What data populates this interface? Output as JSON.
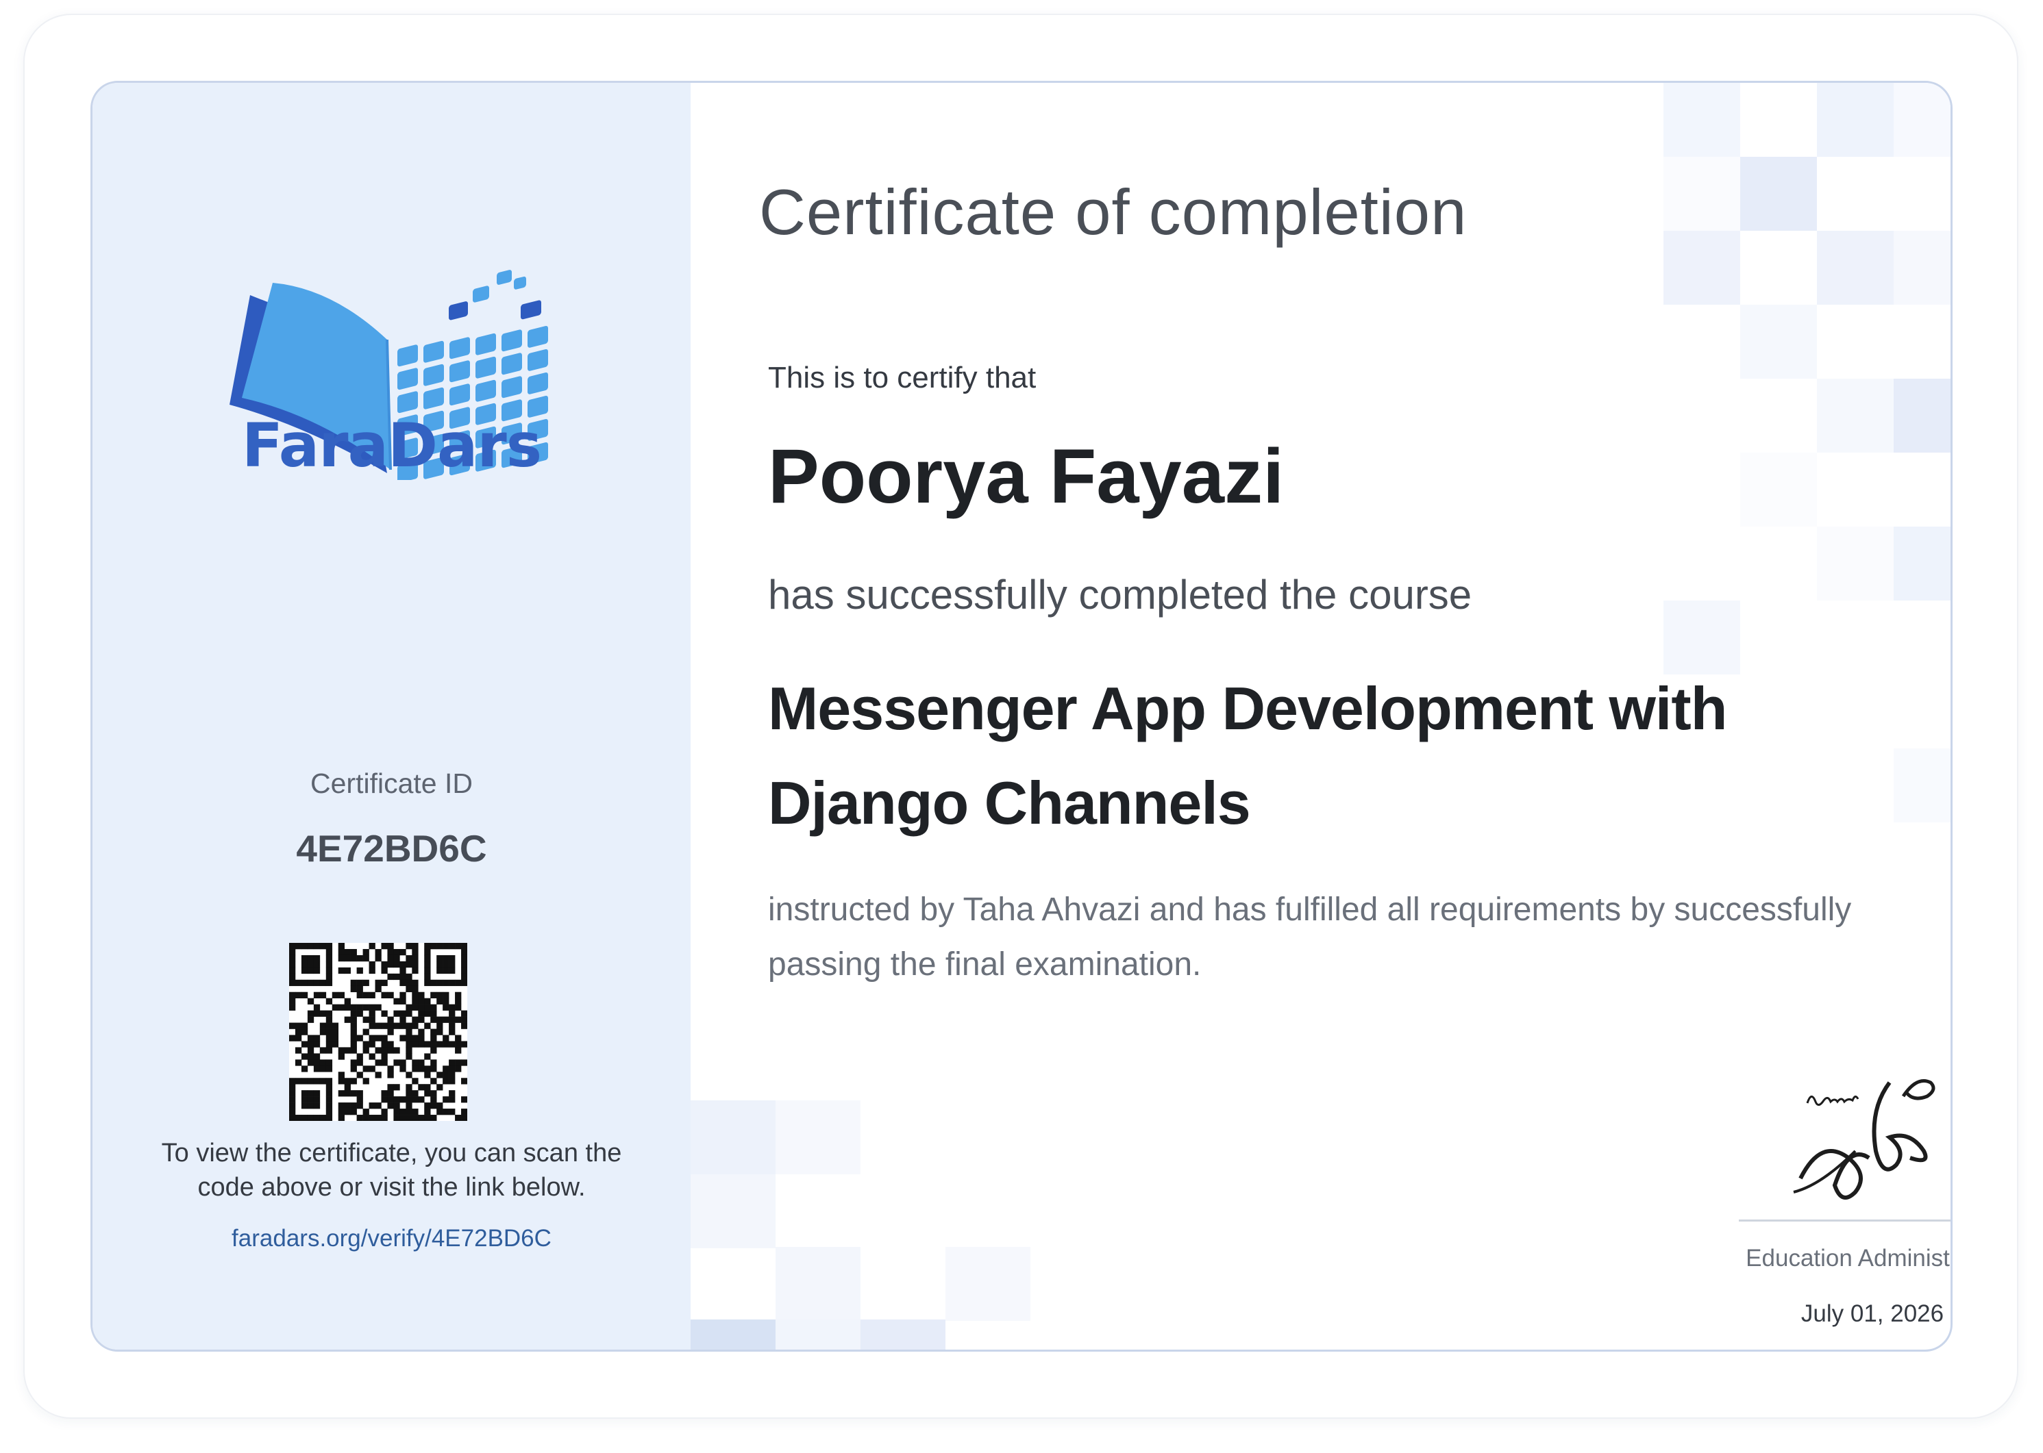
{
  "brand": {
    "name": "FaraDars"
  },
  "certificate": {
    "title": "Certificate of completion",
    "certify_text": "This is to certify that",
    "recipient_name": "Poorya Fayazi",
    "completed_text": "has successfully completed the course",
    "course_name": "Messenger App Development with Django Channels",
    "instructor_text": "instructed by Taha Ahvazi and has fulfilled all requirements by successfully passing the final examination."
  },
  "sidebar": {
    "id_label": "Certificate ID",
    "id_value": "4E72BD6C",
    "scan_text": "To view the certificate, you can scan the code above or visit the link below.",
    "verify_link": "faradars.org/verify/4E72BD6C"
  },
  "signature": {
    "role": "Education Administrator",
    "date": "July 01, 2026"
  },
  "colors": {
    "panel_bg": "#e8f0fb",
    "brand_blue": "#3362c2",
    "link_blue": "#2f5d9c",
    "border": "#c9d5ea"
  },
  "icons": {
    "logo": "open-book-pixel-logo-icon",
    "qr": "qr-code-icon",
    "signature": "handwritten-signature-icon"
  }
}
